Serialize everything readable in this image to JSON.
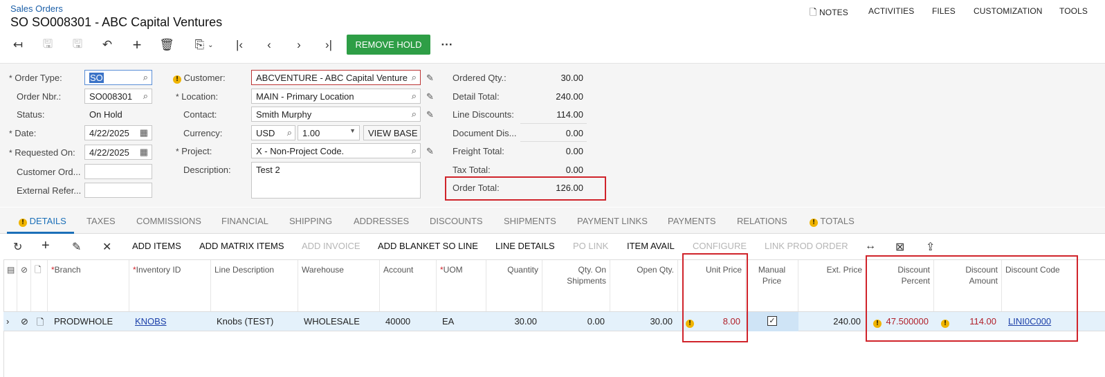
{
  "header": {
    "breadcrumb": "Sales Orders",
    "title": "SO SO008301 - ABC Capital Ventures",
    "nav": [
      "NOTES",
      "ACTIVITIES",
      "FILES",
      "CUSTOMIZATION",
      "TOOLS"
    ]
  },
  "toolbar": {
    "remove_hold": "REMOVE HOLD",
    "more": "···"
  },
  "form": {
    "order_type_label": "Order Type:",
    "order_type": "SO",
    "order_nbr_label": "Order Nbr.:",
    "order_nbr": "SO008301",
    "status_label": "Status:",
    "status": "On Hold",
    "date_label": "Date:",
    "date": "4/22/2025",
    "requested_on_label": "Requested On:",
    "requested_on": "4/22/2025",
    "customer_order_label": "Customer Ord...",
    "external_ref_label": "External Refer...",
    "customer_label": "Customer:",
    "customer": "ABCVENTURE - ABC Capital Venture",
    "location_label": "Location:",
    "location": "MAIN - Primary Location",
    "contact_label": "Contact:",
    "contact": "Smith Murphy",
    "currency_label": "Currency:",
    "currency": "USD",
    "rate": "1.00",
    "view_base": "VIEW BASE",
    "project_label": "Project:",
    "project": "X - Non-Project Code.",
    "description_label": "Description:",
    "description": "Test 2"
  },
  "totals": {
    "ordered_qty_label": "Ordered Qty.:",
    "ordered_qty": "30.00",
    "detail_total_label": "Detail Total:",
    "detail_total": "240.00",
    "line_discounts_label": "Line Discounts:",
    "line_discounts": "114.00",
    "document_dis_label": "Document Dis...",
    "document_dis": "0.00",
    "freight_total_label": "Freight Total:",
    "freight_total": "0.00",
    "tax_total_label": "Tax Total:",
    "tax_total": "0.00",
    "order_total_label": "Order Total:",
    "order_total": "126.00"
  },
  "tabs": [
    "DETAILS",
    "TAXES",
    "COMMISSIONS",
    "FINANCIAL",
    "SHIPPING",
    "ADDRESSES",
    "DISCOUNTS",
    "SHIPMENTS",
    "PAYMENT LINKS",
    "PAYMENTS",
    "RELATIONS",
    "TOTALS"
  ],
  "grid_toolbar": {
    "add_items": "ADD ITEMS",
    "add_matrix_items": "ADD MATRIX ITEMS",
    "add_invoice": "ADD INVOICE",
    "add_blanket": "ADD BLANKET SO LINE",
    "line_details": "LINE DETAILS",
    "po_link": "PO LINK",
    "item_avail": "ITEM AVAIL",
    "configure": "CONFIGURE",
    "link_prod_order": "LINK PROD ORDER"
  },
  "columns": {
    "branch": "Branch",
    "inventory_id": "Inventory ID",
    "line_description": "Line Description",
    "warehouse": "Warehouse",
    "account": "Account",
    "uom": "UOM",
    "quantity": "Quantity",
    "qty_on_shipments": "Qty. On Shipments",
    "open_qty": "Open Qty.",
    "unit_price": "Unit Price",
    "manual_price": "Manual Price",
    "ext_price": "Ext. Price",
    "discount_percent": "Discount Percent",
    "discount_amount": "Discount Amount",
    "discount_code": "Discount Code"
  },
  "row": {
    "branch": "PRODWHOLE",
    "inventory_id": "KNOBS",
    "line_description": "Knobs (TEST)",
    "warehouse": "WHOLESALE",
    "account": "40000",
    "uom": "EA",
    "quantity": "30.00",
    "qty_on_shipments": "0.00",
    "open_qty": "30.00",
    "unit_price": "8.00",
    "manual_price_checked": true,
    "ext_price": "240.00",
    "discount_percent": "47.500000",
    "discount_amount": "114.00",
    "discount_code": "LINI0C000"
  },
  "colors": {
    "accent": "#1b6fb8",
    "green_button": "#2e9e46",
    "highlight_box": "#d0232a",
    "warning": "#f0b400",
    "row_selected": "#e4f1fb"
  }
}
